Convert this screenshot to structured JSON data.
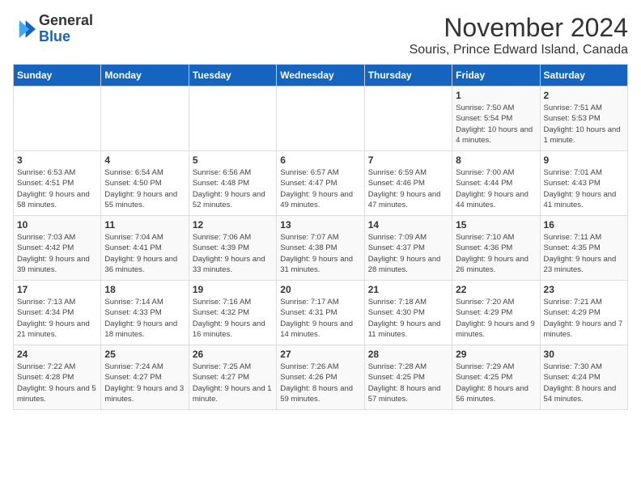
{
  "logo": {
    "general": "General",
    "blue": "Blue"
  },
  "header": {
    "title": "November 2024",
    "location": "Souris, Prince Edward Island, Canada"
  },
  "days_of_week": [
    "Sunday",
    "Monday",
    "Tuesday",
    "Wednesday",
    "Thursday",
    "Friday",
    "Saturday"
  ],
  "weeks": [
    [
      {
        "day": "",
        "info": ""
      },
      {
        "day": "",
        "info": ""
      },
      {
        "day": "",
        "info": ""
      },
      {
        "day": "",
        "info": ""
      },
      {
        "day": "",
        "info": ""
      },
      {
        "day": "1",
        "info": "Sunrise: 7:50 AM\nSunset: 5:54 PM\nDaylight: 10 hours and 4 minutes."
      },
      {
        "day": "2",
        "info": "Sunrise: 7:51 AM\nSunset: 5:53 PM\nDaylight: 10 hours and 1 minute."
      }
    ],
    [
      {
        "day": "3",
        "info": "Sunrise: 6:53 AM\nSunset: 4:51 PM\nDaylight: 9 hours and 58 minutes."
      },
      {
        "day": "4",
        "info": "Sunrise: 6:54 AM\nSunset: 4:50 PM\nDaylight: 9 hours and 55 minutes."
      },
      {
        "day": "5",
        "info": "Sunrise: 6:56 AM\nSunset: 4:48 PM\nDaylight: 9 hours and 52 minutes."
      },
      {
        "day": "6",
        "info": "Sunrise: 6:57 AM\nSunset: 4:47 PM\nDaylight: 9 hours and 49 minutes."
      },
      {
        "day": "7",
        "info": "Sunrise: 6:59 AM\nSunset: 4:46 PM\nDaylight: 9 hours and 47 minutes."
      },
      {
        "day": "8",
        "info": "Sunrise: 7:00 AM\nSunset: 4:44 PM\nDaylight: 9 hours and 44 minutes."
      },
      {
        "day": "9",
        "info": "Sunrise: 7:01 AM\nSunset: 4:43 PM\nDaylight: 9 hours and 41 minutes."
      }
    ],
    [
      {
        "day": "10",
        "info": "Sunrise: 7:03 AM\nSunset: 4:42 PM\nDaylight: 9 hours and 39 minutes."
      },
      {
        "day": "11",
        "info": "Sunrise: 7:04 AM\nSunset: 4:41 PM\nDaylight: 9 hours and 36 minutes."
      },
      {
        "day": "12",
        "info": "Sunrise: 7:06 AM\nSunset: 4:39 PM\nDaylight: 9 hours and 33 minutes."
      },
      {
        "day": "13",
        "info": "Sunrise: 7:07 AM\nSunset: 4:38 PM\nDaylight: 9 hours and 31 minutes."
      },
      {
        "day": "14",
        "info": "Sunrise: 7:09 AM\nSunset: 4:37 PM\nDaylight: 9 hours and 28 minutes."
      },
      {
        "day": "15",
        "info": "Sunrise: 7:10 AM\nSunset: 4:36 PM\nDaylight: 9 hours and 26 minutes."
      },
      {
        "day": "16",
        "info": "Sunrise: 7:11 AM\nSunset: 4:35 PM\nDaylight: 9 hours and 23 minutes."
      }
    ],
    [
      {
        "day": "17",
        "info": "Sunrise: 7:13 AM\nSunset: 4:34 PM\nDaylight: 9 hours and 21 minutes."
      },
      {
        "day": "18",
        "info": "Sunrise: 7:14 AM\nSunset: 4:33 PM\nDaylight: 9 hours and 18 minutes."
      },
      {
        "day": "19",
        "info": "Sunrise: 7:16 AM\nSunset: 4:32 PM\nDaylight: 9 hours and 16 minutes."
      },
      {
        "day": "20",
        "info": "Sunrise: 7:17 AM\nSunset: 4:31 PM\nDaylight: 9 hours and 14 minutes."
      },
      {
        "day": "21",
        "info": "Sunrise: 7:18 AM\nSunset: 4:30 PM\nDaylight: 9 hours and 11 minutes."
      },
      {
        "day": "22",
        "info": "Sunrise: 7:20 AM\nSunset: 4:29 PM\nDaylight: 9 hours and 9 minutes."
      },
      {
        "day": "23",
        "info": "Sunrise: 7:21 AM\nSunset: 4:29 PM\nDaylight: 9 hours and 7 minutes."
      }
    ],
    [
      {
        "day": "24",
        "info": "Sunrise: 7:22 AM\nSunset: 4:28 PM\nDaylight: 9 hours and 5 minutes."
      },
      {
        "day": "25",
        "info": "Sunrise: 7:24 AM\nSunset: 4:27 PM\nDaylight: 9 hours and 3 minutes."
      },
      {
        "day": "26",
        "info": "Sunrise: 7:25 AM\nSunset: 4:27 PM\nDaylight: 9 hours and 1 minute."
      },
      {
        "day": "27",
        "info": "Sunrise: 7:26 AM\nSunset: 4:26 PM\nDaylight: 8 hours and 59 minutes."
      },
      {
        "day": "28",
        "info": "Sunrise: 7:28 AM\nSunset: 4:25 PM\nDaylight: 8 hours and 57 minutes."
      },
      {
        "day": "29",
        "info": "Sunrise: 7:29 AM\nSunset: 4:25 PM\nDaylight: 8 hours and 56 minutes."
      },
      {
        "day": "30",
        "info": "Sunrise: 7:30 AM\nSunset: 4:24 PM\nDaylight: 8 hours and 54 minutes."
      }
    ]
  ]
}
